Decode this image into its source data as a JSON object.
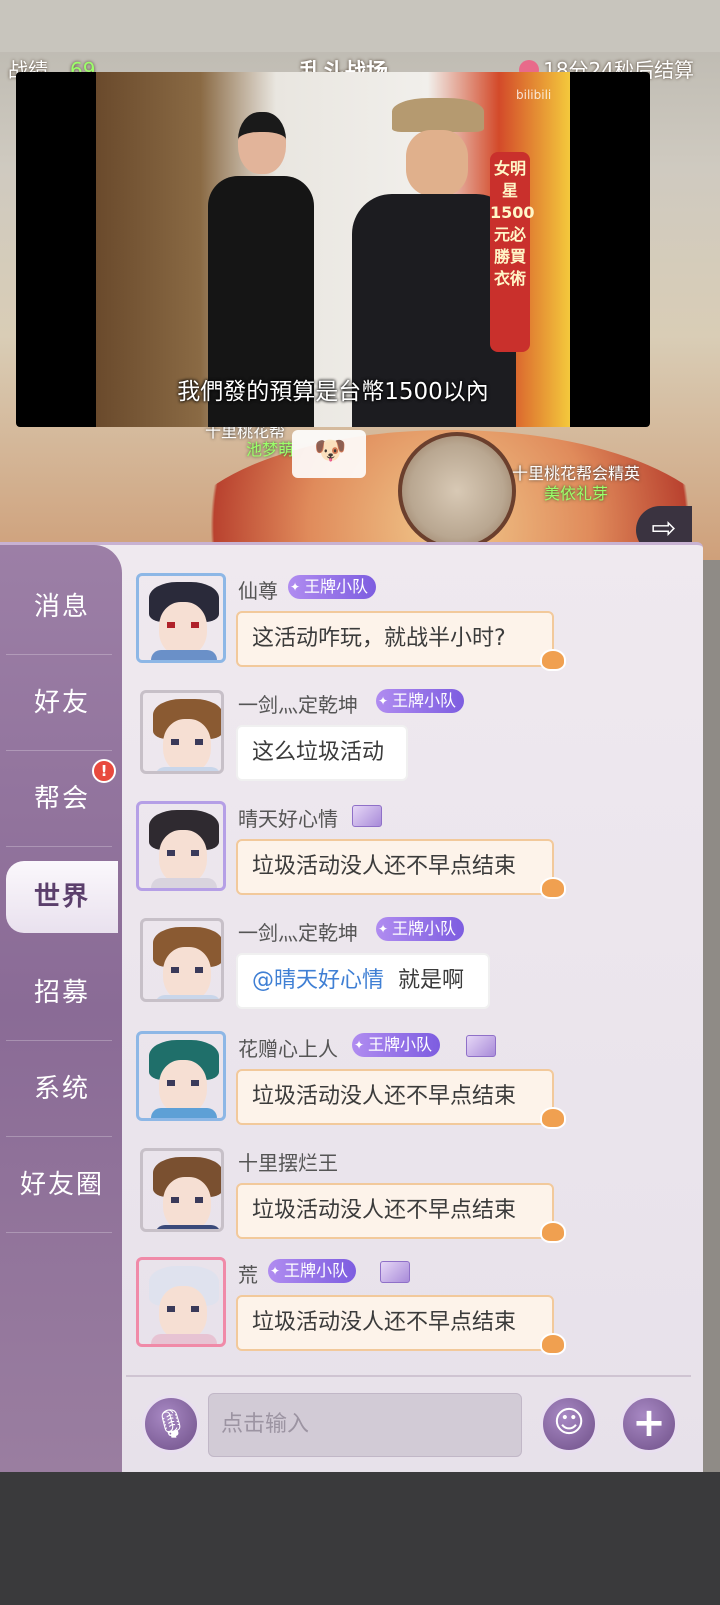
{
  "hud": {
    "left_label": "战绩",
    "left_value": "69",
    "center_title": "乱斗战场",
    "right_timer": "18分24秒后结算"
  },
  "map": {
    "labels": [
      "十里桃花帮",
      "池梦萌",
      "十里桃花帮会精英",
      "美依礼芽"
    ],
    "bubble_emoji": "🐶"
  },
  "video": {
    "watermark": "bilibili",
    "banner": "女明星1500元必勝買衣術",
    "subtitle": "我們發的預算是台幣1500以內"
  },
  "sidebar": {
    "items": [
      {
        "label": "消息"
      },
      {
        "label": "好友"
      },
      {
        "label": "帮会",
        "alert": "!"
      },
      {
        "label": "世界",
        "active": true
      },
      {
        "label": "招募"
      },
      {
        "label": "系统"
      },
      {
        "label": "好友圈"
      }
    ]
  },
  "messages": [
    {
      "name": "仙尊",
      "badge": "王牌小队",
      "text": "这活动咋玩，就战半小时?"
    },
    {
      "name": "一剑灬定乾坤",
      "badge": "王牌小队",
      "text": "这么垃圾活动"
    },
    {
      "name": "晴天好心情",
      "text": "垃圾活动没人还不早点结束"
    },
    {
      "name": "一剑灬定乾坤",
      "badge": "王牌小队",
      "mention": "@晴天好心情",
      "text": "就是啊"
    },
    {
      "name": "花赠心上人",
      "badge": "王牌小队",
      "text": "垃圾活动没人还不早点结束"
    },
    {
      "name": "十里摆烂王",
      "text": "垃圾活动没人还不早点结束"
    },
    {
      "name": "荒",
      "badge": "王牌小队",
      "text": "垃圾活动没人还不早点结束"
    }
  ],
  "input": {
    "placeholder": "点击输入",
    "mic_icon": "🎙",
    "emoji_icon": "☺",
    "plus_icon": "+"
  },
  "map_exit_icon": "⇨",
  "colors": {
    "sidebar": "#8a6b96",
    "badge": "#7d5de0",
    "mention": "#3f7fd4",
    "bubble_border": "#f2c99b"
  }
}
